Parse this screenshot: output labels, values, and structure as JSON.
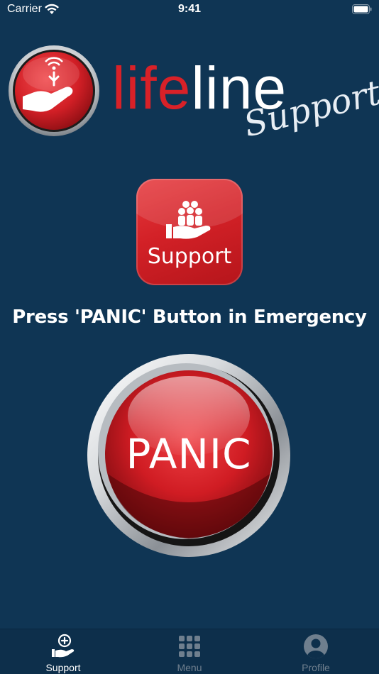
{
  "status_bar": {
    "carrier": "Carrier",
    "time": "9:41",
    "icons": [
      "wifi-icon",
      "battery-icon"
    ]
  },
  "logo": {
    "word_part1": "life",
    "word_part2": "line",
    "tagline": "Support",
    "badge_icon": "hand-signal-icon",
    "colors": {
      "red": "#d82128",
      "white": "#ffffff"
    }
  },
  "support_button": {
    "label": "Support",
    "icon": "people-in-hand-icon"
  },
  "instruction": "Press 'PANIC' Button in Emergency",
  "panic_button": {
    "label": "PANIC"
  },
  "tab_bar": {
    "tabs": [
      {
        "label": "Support",
        "icon": "hand-plus-icon",
        "active": true
      },
      {
        "label": "Menu",
        "icon": "grid-icon",
        "active": false
      },
      {
        "label": "Profile",
        "icon": "user-avatar-icon",
        "active": false
      }
    ]
  },
  "colors": {
    "background": "#0f3554",
    "accent_red": "#d32127",
    "tab_inactive": "#6f7f8e"
  }
}
